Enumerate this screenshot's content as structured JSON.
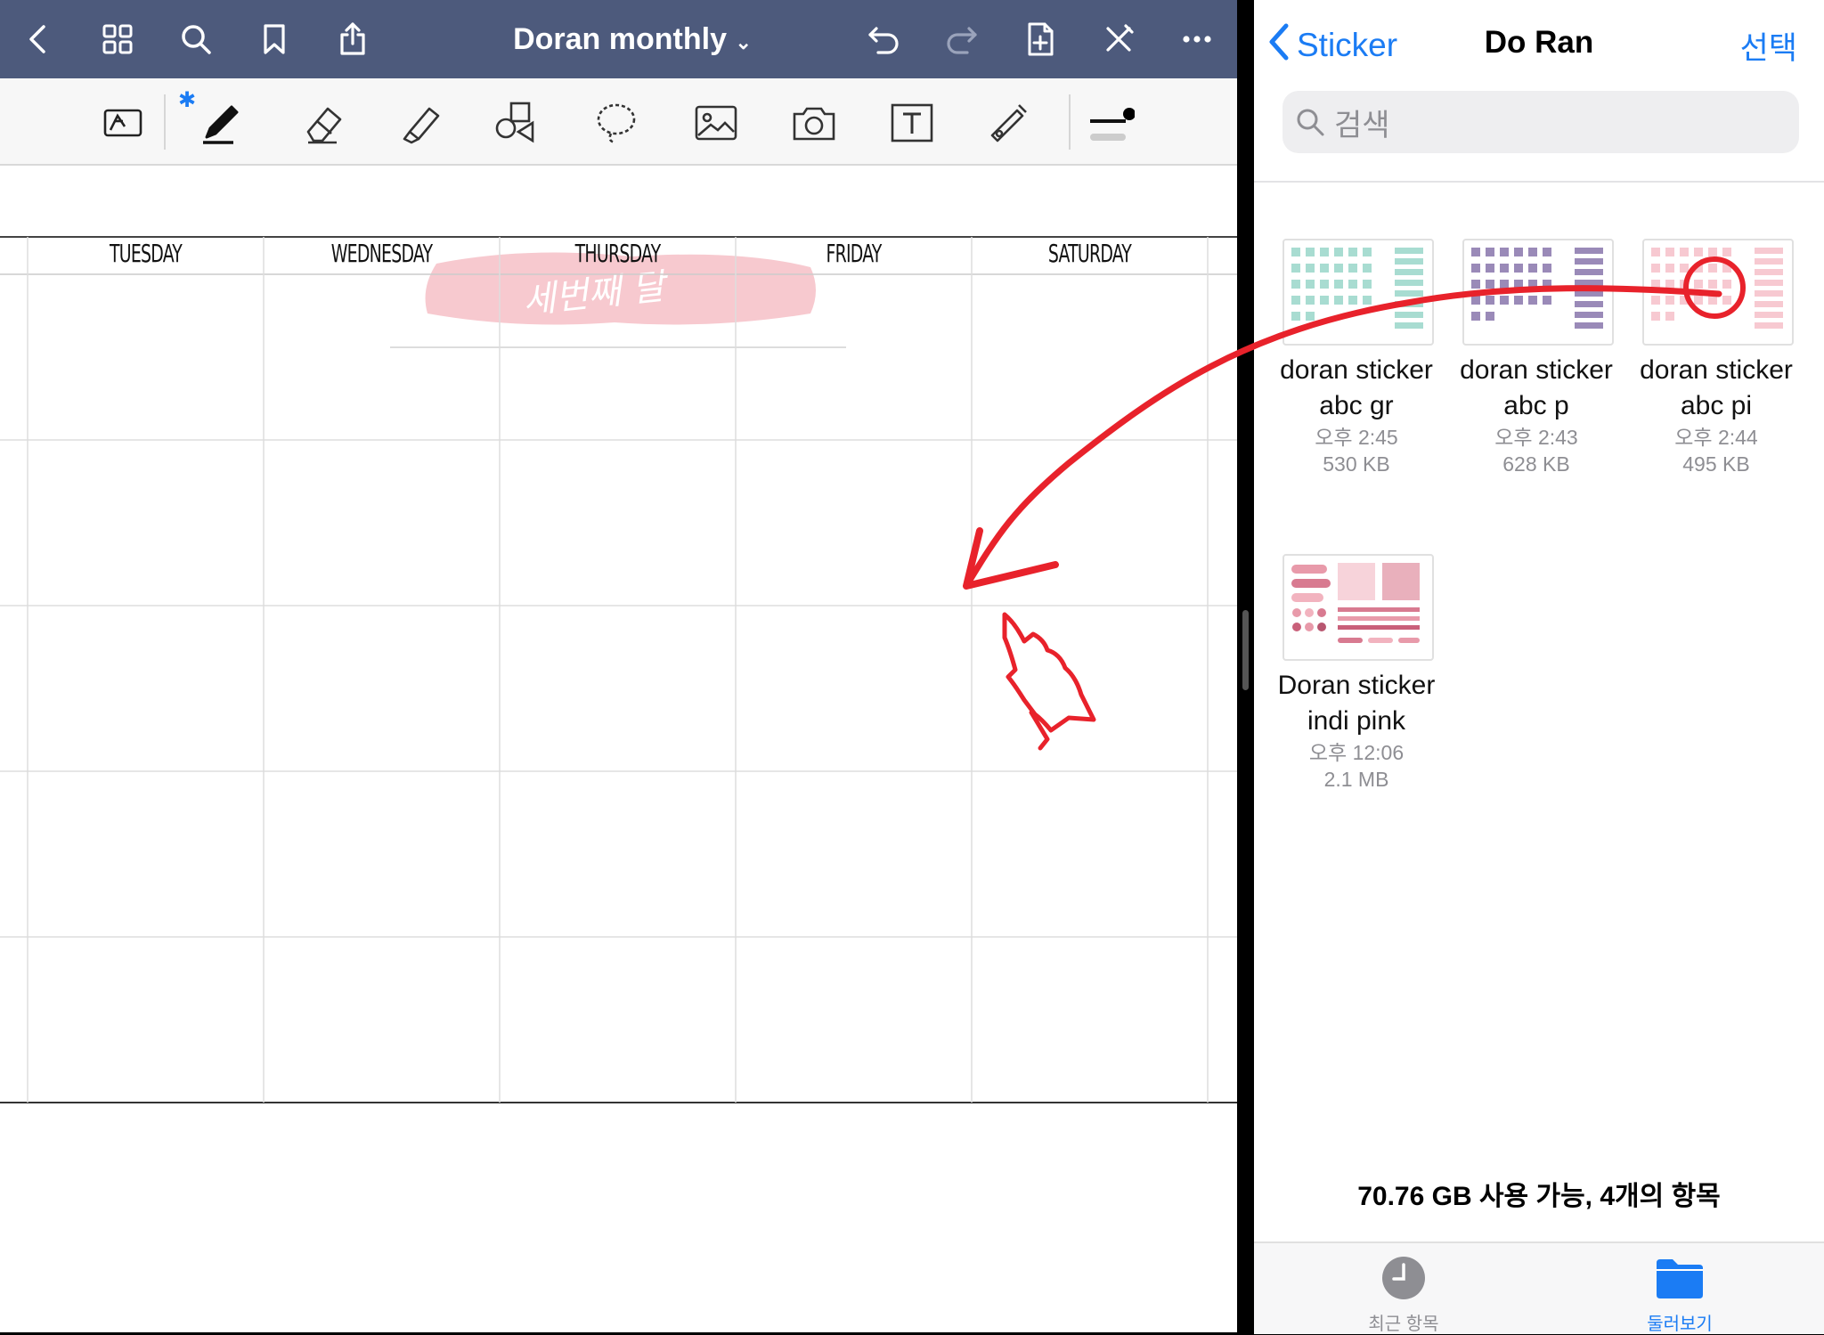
{
  "left_app": {
    "title": "Doran monthly",
    "header_handwriting": "세번째 달",
    "days": [
      "TUESDAY",
      "WEDNESDAY",
      "THURSDAY",
      "FRIDAY",
      "SATURDAY"
    ],
    "top_icons": [
      "back-icon",
      "thumbnails-icon",
      "search-icon",
      "bookmark-icon",
      "share-icon",
      "chevron-down-icon",
      "undo-icon",
      "redo-icon",
      "add-page-icon",
      "close-pen-icon",
      "more-icon"
    ],
    "tools": [
      "read-mode-icon",
      "bluetooth-icon",
      "pen-icon",
      "eraser-icon",
      "highlighter-icon",
      "shapes-icon",
      "lasso-icon",
      "image-icon",
      "camera-icon",
      "text-icon",
      "laser-pointer-icon",
      "stroke-size-icon"
    ]
  },
  "right_app": {
    "back_label": "Sticker",
    "title": "Do Ran",
    "select_label": "선택",
    "search_placeholder": "검색",
    "files": [
      {
        "name1": "doran sticker",
        "name2": "abc gr",
        "time": "오후 2:45",
        "size": "530 KB"
      },
      {
        "name1": "doran sticker",
        "name2": "abc p",
        "time": "오후 2:43",
        "size": "628 KB"
      },
      {
        "name1": "doran sticker",
        "name2": "abc pi",
        "time": "오후 2:44",
        "size": "495 KB"
      },
      {
        "name1": "Doran sticker",
        "name2": "indi pink",
        "time": "오후 12:06",
        "size": "2.1 MB"
      }
    ],
    "footer": "70.76 GB 사용 가능, 4개의 항목",
    "tabs": [
      {
        "label": "최근 항목",
        "icon": "clock-icon"
      },
      {
        "label": "둘러보기",
        "icon": "folder-icon"
      }
    ]
  },
  "colors": {
    "topbar": "#4d5a7c",
    "ios_blue": "#1b7cf4",
    "annotation_red": "#e8222b",
    "header_pink": "#f7c9cf"
  }
}
